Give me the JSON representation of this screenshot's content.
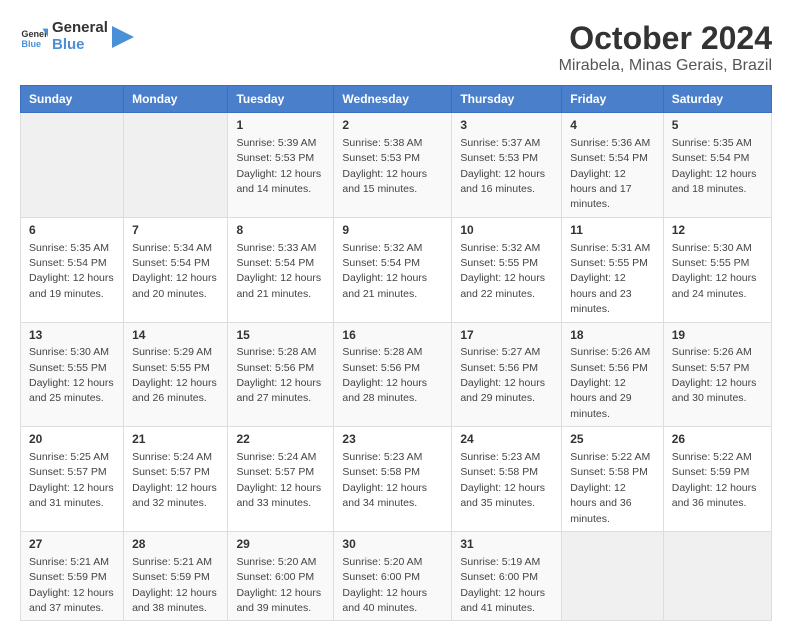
{
  "logo": {
    "line1": "General",
    "line2": "Blue"
  },
  "title": "October 2024",
  "subtitle": "Mirabela, Minas Gerais, Brazil",
  "days_header": [
    "Sunday",
    "Monday",
    "Tuesday",
    "Wednesday",
    "Thursday",
    "Friday",
    "Saturday"
  ],
  "weeks": [
    [
      {
        "day": "",
        "sunrise": "",
        "sunset": "",
        "daylight": ""
      },
      {
        "day": "",
        "sunrise": "",
        "sunset": "",
        "daylight": ""
      },
      {
        "day": "1",
        "sunrise": "Sunrise: 5:39 AM",
        "sunset": "Sunset: 5:53 PM",
        "daylight": "Daylight: 12 hours and 14 minutes."
      },
      {
        "day": "2",
        "sunrise": "Sunrise: 5:38 AM",
        "sunset": "Sunset: 5:53 PM",
        "daylight": "Daylight: 12 hours and 15 minutes."
      },
      {
        "day": "3",
        "sunrise": "Sunrise: 5:37 AM",
        "sunset": "Sunset: 5:53 PM",
        "daylight": "Daylight: 12 hours and 16 minutes."
      },
      {
        "day": "4",
        "sunrise": "Sunrise: 5:36 AM",
        "sunset": "Sunset: 5:54 PM",
        "daylight": "Daylight: 12 hours and 17 minutes."
      },
      {
        "day": "5",
        "sunrise": "Sunrise: 5:35 AM",
        "sunset": "Sunset: 5:54 PM",
        "daylight": "Daylight: 12 hours and 18 minutes."
      }
    ],
    [
      {
        "day": "6",
        "sunrise": "Sunrise: 5:35 AM",
        "sunset": "Sunset: 5:54 PM",
        "daylight": "Daylight: 12 hours and 19 minutes."
      },
      {
        "day": "7",
        "sunrise": "Sunrise: 5:34 AM",
        "sunset": "Sunset: 5:54 PM",
        "daylight": "Daylight: 12 hours and 20 minutes."
      },
      {
        "day": "8",
        "sunrise": "Sunrise: 5:33 AM",
        "sunset": "Sunset: 5:54 PM",
        "daylight": "Daylight: 12 hours and 21 minutes."
      },
      {
        "day": "9",
        "sunrise": "Sunrise: 5:32 AM",
        "sunset": "Sunset: 5:54 PM",
        "daylight": "Daylight: 12 hours and 21 minutes."
      },
      {
        "day": "10",
        "sunrise": "Sunrise: 5:32 AM",
        "sunset": "Sunset: 5:55 PM",
        "daylight": "Daylight: 12 hours and 22 minutes."
      },
      {
        "day": "11",
        "sunrise": "Sunrise: 5:31 AM",
        "sunset": "Sunset: 5:55 PM",
        "daylight": "Daylight: 12 hours and 23 minutes."
      },
      {
        "day": "12",
        "sunrise": "Sunrise: 5:30 AM",
        "sunset": "Sunset: 5:55 PM",
        "daylight": "Daylight: 12 hours and 24 minutes."
      }
    ],
    [
      {
        "day": "13",
        "sunrise": "Sunrise: 5:30 AM",
        "sunset": "Sunset: 5:55 PM",
        "daylight": "Daylight: 12 hours and 25 minutes."
      },
      {
        "day": "14",
        "sunrise": "Sunrise: 5:29 AM",
        "sunset": "Sunset: 5:55 PM",
        "daylight": "Daylight: 12 hours and 26 minutes."
      },
      {
        "day": "15",
        "sunrise": "Sunrise: 5:28 AM",
        "sunset": "Sunset: 5:56 PM",
        "daylight": "Daylight: 12 hours and 27 minutes."
      },
      {
        "day": "16",
        "sunrise": "Sunrise: 5:28 AM",
        "sunset": "Sunset: 5:56 PM",
        "daylight": "Daylight: 12 hours and 28 minutes."
      },
      {
        "day": "17",
        "sunrise": "Sunrise: 5:27 AM",
        "sunset": "Sunset: 5:56 PM",
        "daylight": "Daylight: 12 hours and 29 minutes."
      },
      {
        "day": "18",
        "sunrise": "Sunrise: 5:26 AM",
        "sunset": "Sunset: 5:56 PM",
        "daylight": "Daylight: 12 hours and 29 minutes."
      },
      {
        "day": "19",
        "sunrise": "Sunrise: 5:26 AM",
        "sunset": "Sunset: 5:57 PM",
        "daylight": "Daylight: 12 hours and 30 minutes."
      }
    ],
    [
      {
        "day": "20",
        "sunrise": "Sunrise: 5:25 AM",
        "sunset": "Sunset: 5:57 PM",
        "daylight": "Daylight: 12 hours and 31 minutes."
      },
      {
        "day": "21",
        "sunrise": "Sunrise: 5:24 AM",
        "sunset": "Sunset: 5:57 PM",
        "daylight": "Daylight: 12 hours and 32 minutes."
      },
      {
        "day": "22",
        "sunrise": "Sunrise: 5:24 AM",
        "sunset": "Sunset: 5:57 PM",
        "daylight": "Daylight: 12 hours and 33 minutes."
      },
      {
        "day": "23",
        "sunrise": "Sunrise: 5:23 AM",
        "sunset": "Sunset: 5:58 PM",
        "daylight": "Daylight: 12 hours and 34 minutes."
      },
      {
        "day": "24",
        "sunrise": "Sunrise: 5:23 AM",
        "sunset": "Sunset: 5:58 PM",
        "daylight": "Daylight: 12 hours and 35 minutes."
      },
      {
        "day": "25",
        "sunrise": "Sunrise: 5:22 AM",
        "sunset": "Sunset: 5:58 PM",
        "daylight": "Daylight: 12 hours and 36 minutes."
      },
      {
        "day": "26",
        "sunrise": "Sunrise: 5:22 AM",
        "sunset": "Sunset: 5:59 PM",
        "daylight": "Daylight: 12 hours and 36 minutes."
      }
    ],
    [
      {
        "day": "27",
        "sunrise": "Sunrise: 5:21 AM",
        "sunset": "Sunset: 5:59 PM",
        "daylight": "Daylight: 12 hours and 37 minutes."
      },
      {
        "day": "28",
        "sunrise": "Sunrise: 5:21 AM",
        "sunset": "Sunset: 5:59 PM",
        "daylight": "Daylight: 12 hours and 38 minutes."
      },
      {
        "day": "29",
        "sunrise": "Sunrise: 5:20 AM",
        "sunset": "Sunset: 6:00 PM",
        "daylight": "Daylight: 12 hours and 39 minutes."
      },
      {
        "day": "30",
        "sunrise": "Sunrise: 5:20 AM",
        "sunset": "Sunset: 6:00 PM",
        "daylight": "Daylight: 12 hours and 40 minutes."
      },
      {
        "day": "31",
        "sunrise": "Sunrise: 5:19 AM",
        "sunset": "Sunset: 6:00 PM",
        "daylight": "Daylight: 12 hours and 41 minutes."
      },
      {
        "day": "",
        "sunrise": "",
        "sunset": "",
        "daylight": ""
      },
      {
        "day": "",
        "sunrise": "",
        "sunset": "",
        "daylight": ""
      }
    ]
  ]
}
